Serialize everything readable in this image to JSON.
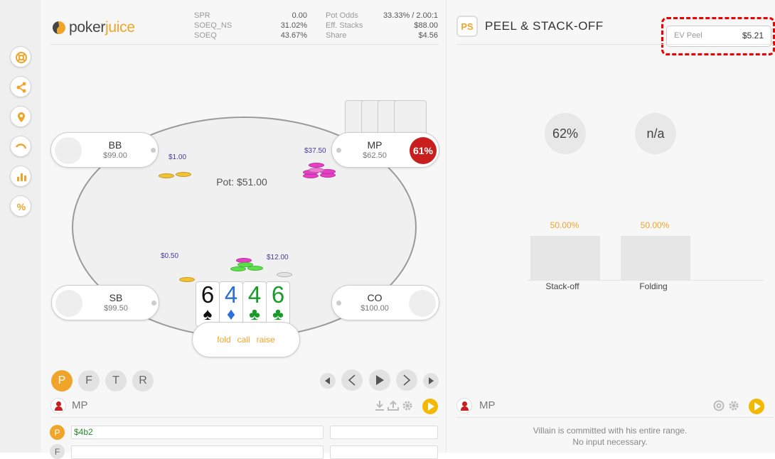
{
  "brand": {
    "logo_a": "poker",
    "logo_b": "juice"
  },
  "stats": {
    "spr_label": "SPR",
    "spr": "0.00",
    "soeq_ns_label": "SOEQ_NS",
    "soeq_ns": "31.02%",
    "soeq_label": "SOEQ",
    "soeq": "43.67%",
    "pot_odds_label": "Pot Odds",
    "pot_odds": "33.33% / 2.00:1",
    "eff_stacks_label": "Eff. Stacks",
    "eff_stacks": "$88.00",
    "share_label": "Share",
    "share": "$4.56"
  },
  "table": {
    "pot": "Pot: $51.00",
    "seats": {
      "bb": {
        "name": "BB",
        "stack": "$99.00",
        "bet": "$1.00"
      },
      "mp": {
        "name": "MP",
        "stack": "$62.50",
        "bet": "$37.50",
        "equity": "61%"
      },
      "sb": {
        "name": "SB",
        "stack": "$99.50",
        "bet": "$0.50"
      },
      "co": {
        "name": "CO",
        "stack": "$100.00"
      }
    },
    "hero_bet": "$12.00",
    "hero_cards": [
      {
        "rank": "6",
        "suit": "♠",
        "color": "#111111"
      },
      {
        "rank": "4",
        "suit": "♦",
        "color": "#2f6fd8"
      },
      {
        "rank": "4",
        "suit": "♣",
        "color": "#1a9a2a"
      },
      {
        "rank": "6",
        "suit": "♣",
        "color": "#1a9a2a"
      }
    ],
    "actions": {
      "fold": "fold",
      "call": "call",
      "raise": "raise"
    }
  },
  "streets": [
    "P",
    "F",
    "T",
    "R"
  ],
  "history": {
    "player": "MP",
    "rows": [
      {
        "street": "P",
        "value": "$4b2"
      },
      {
        "street": "F",
        "value": ""
      }
    ]
  },
  "panel": {
    "badge": "PS",
    "title": "PEEL & STACK-OFF",
    "ev_label": "EV Peel",
    "ev_value": "$5.21",
    "circle_1": "62%",
    "circle_2": "n/a",
    "bars": [
      {
        "label": "Stack-off",
        "pct": "50.00%",
        "fraction": 0.5
      },
      {
        "label": "Folding",
        "pct": "50.00%",
        "fraction": 0.5
      }
    ],
    "villain": "MP",
    "msg_1": "Villain is committed with his entire range.",
    "msg_2": "No input necessary."
  },
  "colors": {
    "accent": "#f0a52a",
    "equity": "#c81e1e",
    "highlight": "#e00000",
    "play": "#f5b800"
  },
  "sidebar_icons": [
    "lifebuoy-icon",
    "share-icon",
    "location-pin-icon",
    "history-arc-icon",
    "bar-chart-icon",
    "percent-icon"
  ]
}
